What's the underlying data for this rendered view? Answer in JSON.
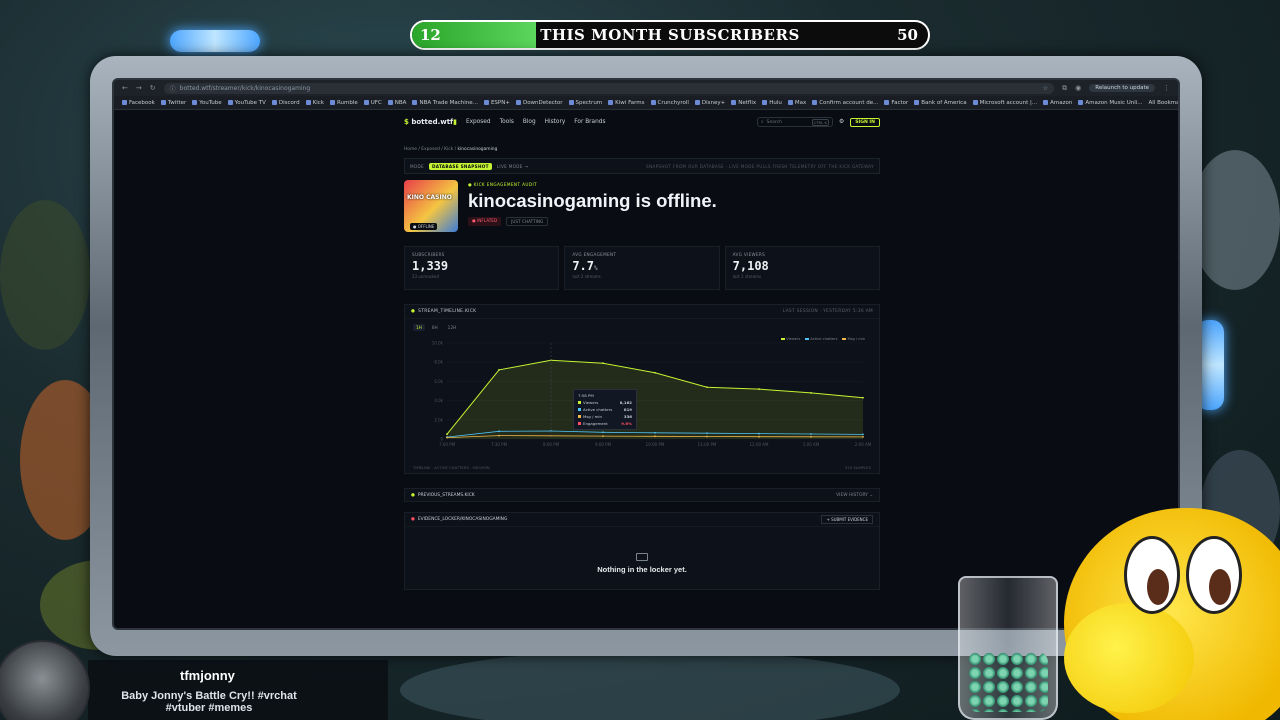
{
  "overlay": {
    "sub_goal": {
      "current": "12",
      "goal": "50",
      "title": "THIS MONTH SUBSCRIBERS",
      "progress": 0.24
    },
    "streamer": {
      "name": "tfmjonny",
      "stream_title": "Baby Jonny's Battle Cry!! #vrchat #vtuber #memes"
    }
  },
  "browser": {
    "url": "botted.wtf/streamer/kick/kinocasinogaming",
    "relaunch_label": "Relaunch to update",
    "bookmarks": [
      "Facebook",
      "Twitter",
      "YouTube",
      "YouTube TV",
      "Discord",
      "Kick",
      "Rumble",
      "UFC",
      "NBA",
      "NBA Trade Machine...",
      "ESPN+",
      "DownDetector",
      "Spectrum",
      "Kiwi Farms",
      "Crunchyroll",
      "Disney+",
      "Netflix",
      "Hulu",
      "Max",
      "Confirm account de...",
      "Factor",
      "Bank of America",
      "Microsoft account |...",
      "Amazon",
      "Amazon Music Unli..."
    ],
    "all_bookmarks": "All Bookmarks"
  },
  "site": {
    "logo": "botted.wtf",
    "nav": [
      "Exposed",
      "Tools",
      "Blog",
      "History",
      "For Brands"
    ],
    "search_placeholder": "Search",
    "search_kbd": "CTRL K",
    "sign_in": "SIGN IN",
    "breadcrumb": [
      "Home",
      "Exposed",
      "Kick",
      "kinocasinogaming"
    ],
    "mode": {
      "label": "MODE",
      "active": "DATABASE SNAPSHOT",
      "other": "LIVE MODE →",
      "note": "SNAPSHOT FROM OUR DATABASE · LIVE MODE PULLS FRESH TELEMETRY OFF THE KICK GATEWAY"
    },
    "hero": {
      "kicker": "● KICK ENGAGEMENT AUDIT",
      "title": "kinocasinogaming is offline.",
      "offline_badge": "● OFFLINE",
      "thumb_text": "KINO CASINO",
      "tag_inflated": "● INFLATED",
      "tag_chatting": "JUST CHATTING"
    },
    "stats": [
      {
        "label": "SUBSCRIBERS",
        "value": "1,339",
        "sub": "23 unmasked"
      },
      {
        "label": "AVG ENGAGEMENT",
        "value": "7.7",
        "unit": "%",
        "sub": "last 2 streams"
      },
      {
        "label": "AVG VIEWERS",
        "value": "7,108",
        "sub": "last 2 streams"
      }
    ],
    "timeline": {
      "title": "STREAM_TIMELINE.KICK",
      "right": "LAST SESSION · YESTERDAY 5:36 AM",
      "timeframes": [
        "1H",
        "6H",
        "12H"
      ],
      "active_timeframe": "1H",
      "legend": [
        "Viewers",
        "Active chatters",
        "Msg / min"
      ],
      "footer_left": "TIMELINE · ACTIVE CHATTERS · MSG/MIN",
      "footer_right": "519 SAMPLES",
      "tooltip": {
        "time": "7:58 PM",
        "rows": [
          {
            "label": "Viewers",
            "value": "8,162",
            "color": "#c6f432"
          },
          {
            "label": "Active chatters",
            "value": "819",
            "color": "#4fc3f7"
          },
          {
            "label": "Msg / min",
            "value": "336",
            "color": "#f2b84b"
          },
          {
            "label": "Engagement",
            "value": "9.6%",
            "color": "#ff4d63"
          }
        ]
      },
      "y_ticks": [
        "10.0k",
        "8.0k",
        "6.0k",
        "4.0k",
        "2.0k",
        "0"
      ],
      "x_ticks": [
        "7:00 PM",
        "7:30 PM",
        "8:00 PM",
        "9:00 PM",
        "10:00 PM",
        "11:00 PM",
        "12:00 AM",
        "1:00 AM",
        "2:00 AM"
      ]
    },
    "chart_data": {
      "type": "area",
      "x": [
        "7:00 PM",
        "7:30 PM",
        "8:00 PM",
        "9:00 PM",
        "10:00 PM",
        "11:00 PM",
        "12:00 AM",
        "1:00 AM",
        "2:00 AM"
      ],
      "series": [
        {
          "name": "Viewers",
          "values": [
            500,
            7200,
            8200,
            7900,
            6900,
            5400,
            5200,
            4800,
            4300
          ]
        },
        {
          "name": "Active chatters",
          "values": [
            200,
            800,
            830,
            700,
            650,
            600,
            560,
            520,
            480
          ]
        },
        {
          "name": "Msg / min",
          "values": [
            150,
            350,
            336,
            300,
            280,
            260,
            240,
            230,
            220
          ]
        }
      ],
      "ylim": [
        0,
        10000
      ]
    },
    "previous_streams": {
      "title": "PREVIOUS_STREAMS.KICK",
      "right": "VIEW HISTORY ⌄"
    },
    "locker": {
      "title": "EVIDENCE_LOCKER/KINOCASINOGAMING",
      "button": "+ SUBMIT EVIDENCE",
      "empty": "Nothing in the locker yet."
    }
  }
}
